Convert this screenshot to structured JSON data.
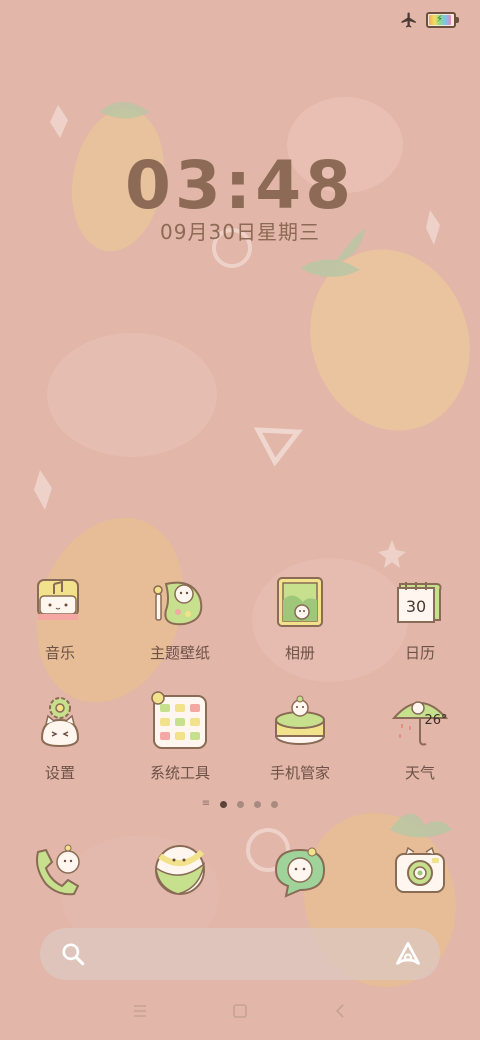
{
  "status": {
    "airplane_mode": true,
    "battery_charging": true,
    "battery_level": 0.85
  },
  "clock": {
    "time": "03:48",
    "date": "09月30日星期三"
  },
  "apps_row1": [
    {
      "label": "音乐",
      "icon": "music-icon"
    },
    {
      "label": "主题壁纸",
      "icon": "theme-wallpaper-icon"
    },
    {
      "label": "相册",
      "icon": "gallery-icon"
    },
    {
      "label": "日历",
      "icon": "calendar-icon",
      "badge": "30"
    }
  ],
  "apps_row2": [
    {
      "label": "设置",
      "icon": "settings-icon"
    },
    {
      "label": "系统工具",
      "icon": "system-tools-icon"
    },
    {
      "label": "手机管家",
      "icon": "phone-manager-icon"
    },
    {
      "label": "天气",
      "icon": "weather-icon",
      "temp": "26°"
    }
  ],
  "dock": [
    {
      "name": "phone",
      "icon": "phone-icon"
    },
    {
      "name": "browser",
      "icon": "browser-icon"
    },
    {
      "name": "messages",
      "icon": "messages-icon"
    },
    {
      "name": "camera",
      "icon": "camera-icon"
    }
  ],
  "page_indicator": {
    "pages": 4,
    "active": 0
  },
  "colors": {
    "background": "#e2b6a8",
    "text": "#6e5246",
    "clock": "#8d6a55",
    "accent_yellow": "#f3e28c",
    "accent_green": "#c6e08e"
  }
}
